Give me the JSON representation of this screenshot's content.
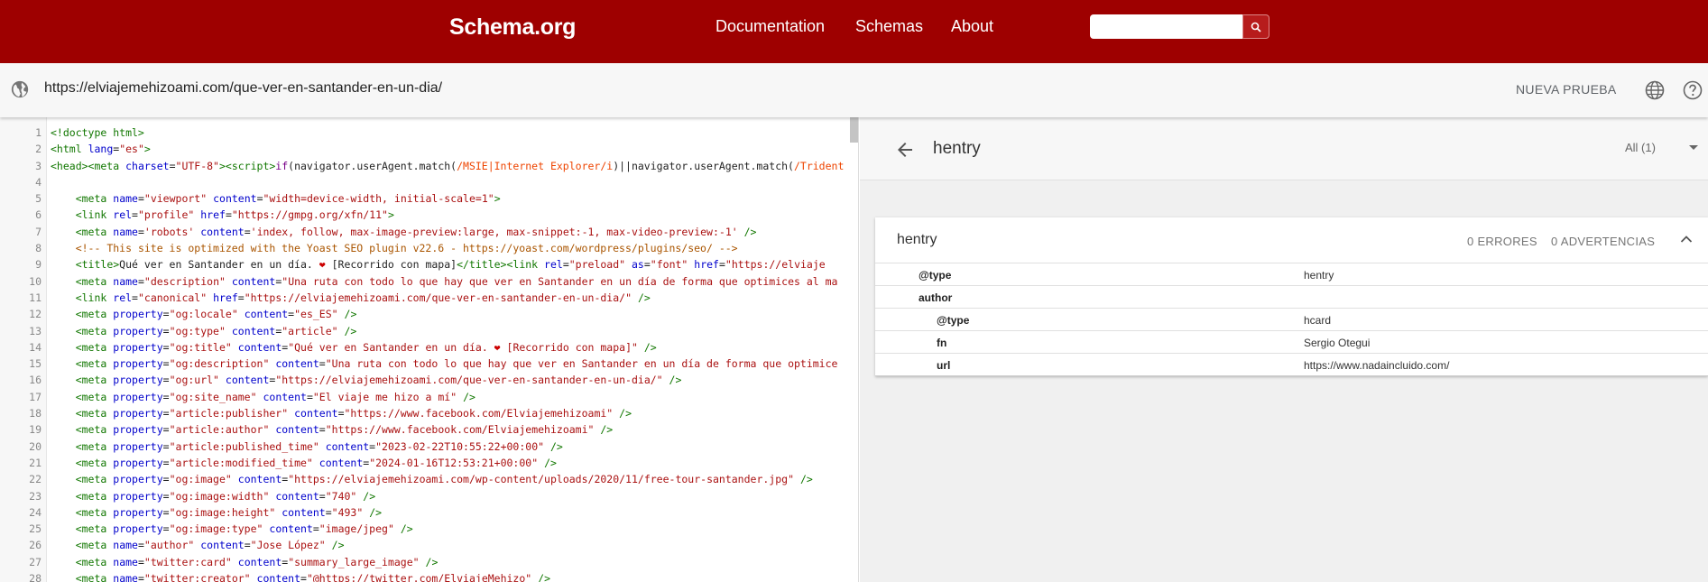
{
  "nav": {
    "logo": "Schema.org",
    "links": [
      "Documentation",
      "Schemas",
      "About"
    ],
    "search_value": ""
  },
  "urlbar": {
    "url": "https://elviajemehizoami.com/que-ver-en-santander-en-un-dia/",
    "new_test": "NUEVA PRUEBA"
  },
  "editor": {
    "lines": [
      {
        "n": "1",
        "html": "<span class=\"tg\">&lt;!doctype html&gt;</span>"
      },
      {
        "n": "2",
        "html": "<span class=\"tg\">&lt;html</span> <span class=\"at\">lang</span>=<span class=\"st\">\"es\"</span><span class=\"tg\">&gt;</span>"
      },
      {
        "n": "3",
        "html": "<span class=\"tg\">&lt;head&gt;&lt;meta</span> <span class=\"at\">charset</span>=<span class=\"st\">\"UTF-8\"</span><span class=\"tg\">&gt;&lt;script&gt;</span><span class=\"kw\">if</span>(navigator.userAgent.match(<span class=\"rx\">/MSIE|Internet Explorer/i</span>)||navigator.userAgent.match(<span class=\"rx\">/Trident</span>"
      },
      {
        "n": "4",
        "html": ""
      },
      {
        "n": "5",
        "html": "    <span class=\"tg\">&lt;meta</span> <span class=\"at\">name</span>=<span class=\"st\">\"viewport\"</span> <span class=\"at\">content</span>=<span class=\"st\">\"width=device-width, initial-scale=1\"</span><span class=\"tg\">&gt;</span>"
      },
      {
        "n": "6",
        "html": "    <span class=\"tg\">&lt;link</span> <span class=\"at\">rel</span>=<span class=\"st\">\"profile\"</span> <span class=\"at\">href</span>=<span class=\"st\">\"https://gmpg.org/xfn/11\"</span><span class=\"tg\">&gt;</span>"
      },
      {
        "n": "7",
        "html": "    <span class=\"tg\">&lt;meta</span> <span class=\"at\">name</span>=<span class=\"st\">'robots'</span> <span class=\"at\">content</span>=<span class=\"st\">'index, follow, max-image-preview:large, max-snippet:-1, max-video-preview:-1'</span> <span class=\"tg\">/&gt;</span>"
      },
      {
        "n": "8",
        "html": "    <span class=\"cm\">&lt;!-- This site is optimized with the Yoast SEO plugin v22.6 - https://yoast.com/wordpress/plugins/seo/ --&gt;</span>"
      },
      {
        "n": "9",
        "html": "    <span class=\"tg\">&lt;title&gt;</span>Qué ver en Santander en un día. <span style=\"color:#c00\">❤</span> [Recorrido con mapa]<span class=\"tg\">&lt;/title&gt;&lt;link</span> <span class=\"at\">rel</span>=<span class=\"st\">\"preload\"</span> <span class=\"at\">as</span>=<span class=\"st\">\"font\"</span> <span class=\"at\">href</span>=<span class=\"st\">\"https://elviaje</span>"
      },
      {
        "n": "10",
        "html": "    <span class=\"tg\">&lt;meta</span> <span class=\"at\">name</span>=<span class=\"st\">\"description\"</span> <span class=\"at\">content</span>=<span class=\"st\">\"Una ruta con todo lo que hay que ver en Santander en un día de forma que optimices al ma</span>"
      },
      {
        "n": "11",
        "html": "    <span class=\"tg\">&lt;link</span> <span class=\"at\">rel</span>=<span class=\"st\">\"canonical\"</span> <span class=\"at\">href</span>=<span class=\"st\">\"https://elviajemehizoami.com/que-ver-en-santander-en-un-dia/\"</span> <span class=\"tg\">/&gt;</span>"
      },
      {
        "n": "12",
        "html": "    <span class=\"tg\">&lt;meta</span> <span class=\"at\">property</span>=<span class=\"st\">\"og:locale\"</span> <span class=\"at\">content</span>=<span class=\"st\">\"es_ES\"</span> <span class=\"tg\">/&gt;</span>"
      },
      {
        "n": "13",
        "html": "    <span class=\"tg\">&lt;meta</span> <span class=\"at\">property</span>=<span class=\"st\">\"og:type\"</span> <span class=\"at\">content</span>=<span class=\"st\">\"article\"</span> <span class=\"tg\">/&gt;</span>"
      },
      {
        "n": "14",
        "html": "    <span class=\"tg\">&lt;meta</span> <span class=\"at\">property</span>=<span class=\"st\">\"og:title\"</span> <span class=\"at\">content</span>=<span class=\"st\">\"Qué ver en Santander en un día. <span style=\"color:#c00\">❤</span> [Recorrido con mapa]\"</span> <span class=\"tg\">/&gt;</span>"
      },
      {
        "n": "15",
        "html": "    <span class=\"tg\">&lt;meta</span> <span class=\"at\">property</span>=<span class=\"st\">\"og:description\"</span> <span class=\"at\">content</span>=<span class=\"st\">\"Una ruta con todo lo que hay que ver en Santander en un día de forma que optimice</span>"
      },
      {
        "n": "16",
        "html": "    <span class=\"tg\">&lt;meta</span> <span class=\"at\">property</span>=<span class=\"st\">\"og:url\"</span> <span class=\"at\">content</span>=<span class=\"st\">\"https://elviajemehizoami.com/que-ver-en-santander-en-un-dia/\"</span> <span class=\"tg\">/&gt;</span>"
      },
      {
        "n": "17",
        "html": "    <span class=\"tg\">&lt;meta</span> <span class=\"at\">property</span>=<span class=\"st\">\"og:site_name\"</span> <span class=\"at\">content</span>=<span class=\"st\">\"El viaje me hizo a mí\"</span> <span class=\"tg\">/&gt;</span>"
      },
      {
        "n": "18",
        "html": "    <span class=\"tg\">&lt;meta</span> <span class=\"at\">property</span>=<span class=\"st\">\"article:publisher\"</span> <span class=\"at\">content</span>=<span class=\"st\">\"https://www.facebook.com/Elviajemehizoami\"</span> <span class=\"tg\">/&gt;</span>"
      },
      {
        "n": "19",
        "html": "    <span class=\"tg\">&lt;meta</span> <span class=\"at\">property</span>=<span class=\"st\">\"article:author\"</span> <span class=\"at\">content</span>=<span class=\"st\">\"https://www.facebook.com/Elviajemehizoami\"</span> <span class=\"tg\">/&gt;</span>"
      },
      {
        "n": "20",
        "html": "    <span class=\"tg\">&lt;meta</span> <span class=\"at\">property</span>=<span class=\"st\">\"article:published_time\"</span> <span class=\"at\">content</span>=<span class=\"st\">\"2023-02-22T10:55:22+00:00\"</span> <span class=\"tg\">/&gt;</span>"
      },
      {
        "n": "21",
        "html": "    <span class=\"tg\">&lt;meta</span> <span class=\"at\">property</span>=<span class=\"st\">\"article:modified_time\"</span> <span class=\"at\">content</span>=<span class=\"st\">\"2024-01-16T12:53:21+00:00\"</span> <span class=\"tg\">/&gt;</span>"
      },
      {
        "n": "22",
        "html": "    <span class=\"tg\">&lt;meta</span> <span class=\"at\">property</span>=<span class=\"st\">\"og:image\"</span> <span class=\"at\">content</span>=<span class=\"st\">\"https://elviajemehizoami.com/wp-content/uploads/2020/11/free-tour-santander.jpg\"</span> <span class=\"tg\">/&gt;</span>"
      },
      {
        "n": "23",
        "html": "    <span class=\"tg\">&lt;meta</span> <span class=\"at\">property</span>=<span class=\"st\">\"og:image:width\"</span> <span class=\"at\">content</span>=<span class=\"st\">\"740\"</span> <span class=\"tg\">/&gt;</span>"
      },
      {
        "n": "24",
        "html": "    <span class=\"tg\">&lt;meta</span> <span class=\"at\">property</span>=<span class=\"st\">\"og:image:height\"</span> <span class=\"at\">content</span>=<span class=\"st\">\"493\"</span> <span class=\"tg\">/&gt;</span>"
      },
      {
        "n": "25",
        "html": "    <span class=\"tg\">&lt;meta</span> <span class=\"at\">property</span>=<span class=\"st\">\"og:image:type\"</span> <span class=\"at\">content</span>=<span class=\"st\">\"image/jpeg\"</span> <span class=\"tg\">/&gt;</span>"
      },
      {
        "n": "26",
        "html": "    <span class=\"tg\">&lt;meta</span> <span class=\"at\">name</span>=<span class=\"st\">\"author\"</span> <span class=\"at\">content</span>=<span class=\"st\">\"Jose López\"</span> <span class=\"tg\">/&gt;</span>"
      },
      {
        "n": "27",
        "html": "    <span class=\"tg\">&lt;meta</span> <span class=\"at\">name</span>=<span class=\"st\">\"twitter:card\"</span> <span class=\"at\">content</span>=<span class=\"st\">\"summary_large_image\"</span> <span class=\"tg\">/&gt;</span>"
      },
      {
        "n": "28",
        "html": "    <span class=\"tg\">&lt;meta</span> <span class=\"at\">name</span>=<span class=\"st\">\"twitter:creator\"</span> <span class=\"at\">content</span>=<span class=\"st\">\"@https://twitter.com/ElviajeMehizo\"</span> <span class=\"tg\">/&gt;</span>"
      }
    ]
  },
  "panel": {
    "title": "hentry",
    "filter": "All (1)",
    "card": {
      "title": "hentry",
      "errors": "0 ERRORES",
      "warnings": "0 ADVERTENCIAS",
      "rows": [
        {
          "key": "@type",
          "value": "hentry",
          "indent": 0
        },
        {
          "key": "author",
          "value": "",
          "indent": 0
        },
        {
          "key": "@type",
          "value": "hcard",
          "indent": 1
        },
        {
          "key": "fn",
          "value": "Sergio Otegui",
          "indent": 1
        },
        {
          "key": "url",
          "value": "https://www.nadaincluido.com/",
          "indent": 1
        }
      ]
    }
  },
  "colors": {
    "brand": "#9e0000",
    "search_button": "#b71c1c"
  },
  "icons": [
    "search-icon",
    "globe-icon",
    "language-icon",
    "help-icon",
    "back-arrow-icon",
    "chevron-up-icon",
    "dropdown-caret-icon"
  ]
}
